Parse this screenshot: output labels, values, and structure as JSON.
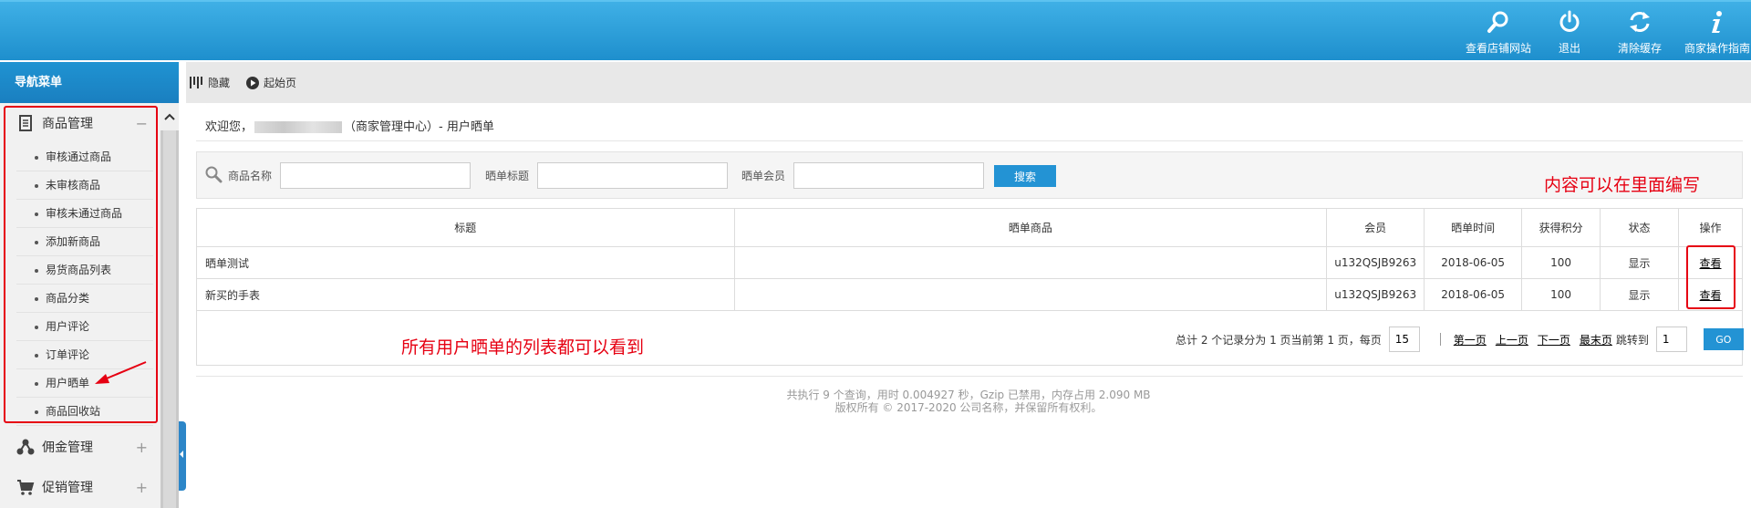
{
  "header": {
    "actions": [
      {
        "label": "查看店铺网站",
        "icon": "search-icon"
      },
      {
        "label": "退出",
        "icon": "power-icon"
      },
      {
        "label": "清除缓存",
        "icon": "refresh-icon"
      },
      {
        "label": "商家操作指南",
        "icon": "info-icon"
      }
    ]
  },
  "sidebar": {
    "title": "导航菜单",
    "groups": [
      {
        "label": "商品管理",
        "icon": "document-icon",
        "toggle": "−"
      },
      {
        "label": "佣金管理",
        "icon": "share-icon",
        "toggle": "+"
      },
      {
        "label": "促销管理",
        "icon": "cart-icon",
        "toggle": "+"
      }
    ],
    "items": [
      "审核通过商品",
      "未审核商品",
      "审核未通过商品",
      "添加新商品",
      "易货商品列表",
      "商品分类",
      "用户评论",
      "订单评论",
      "用户晒单",
      "商品回收站"
    ]
  },
  "toolbar": {
    "hide_label": "隐藏",
    "home_label": "起始页"
  },
  "welcome": {
    "prefix": "欢迎您，",
    "suffix": "（商家管理中心）- 用户晒单"
  },
  "search": {
    "fields": [
      {
        "label": "商品名称",
        "value": ""
      },
      {
        "label": "晒单标题",
        "value": ""
      },
      {
        "label": "晒单会员",
        "value": ""
      }
    ],
    "button": "搜索"
  },
  "annotations": {
    "right": "内容可以在里面编写",
    "left": "所有用户晒单的列表都可以看到"
  },
  "table": {
    "headers": [
      "标题",
      "晒单商品",
      "会员",
      "晒单时间",
      "获得积分",
      "状态",
      "操作"
    ],
    "rows": [
      {
        "title": "晒单测试",
        "product": "",
        "member": "u132QSJB9263",
        "date": "2018-06-05",
        "points": "100",
        "status": "显示",
        "action": "查看"
      },
      {
        "title": "新买的手表",
        "product": "",
        "member": "u132QSJB9263",
        "date": "2018-06-05",
        "points": "100",
        "status": "显示",
        "action": "查看"
      }
    ]
  },
  "pager": {
    "summary": "总计 2 个记录分为 1 页当前第 1 页，每页",
    "per_page": "15",
    "first": "第一页",
    "prev": "上一页",
    "next": "下一页",
    "last": "最末页",
    "jump_label": "跳转到",
    "jump_value": "1",
    "go": "GO"
  },
  "footer": {
    "line1": "共执行 9 个查询，用时 0.004927 秒，Gzip 已禁用，内存占用 2.090 MB",
    "line2": "版权所有 © 2017-2020 公司名称，并保留所有权利。"
  },
  "colors": {
    "header_blue": "#2fa3dd",
    "button_blue": "#2393d4",
    "annotation_red": "#e60012"
  }
}
